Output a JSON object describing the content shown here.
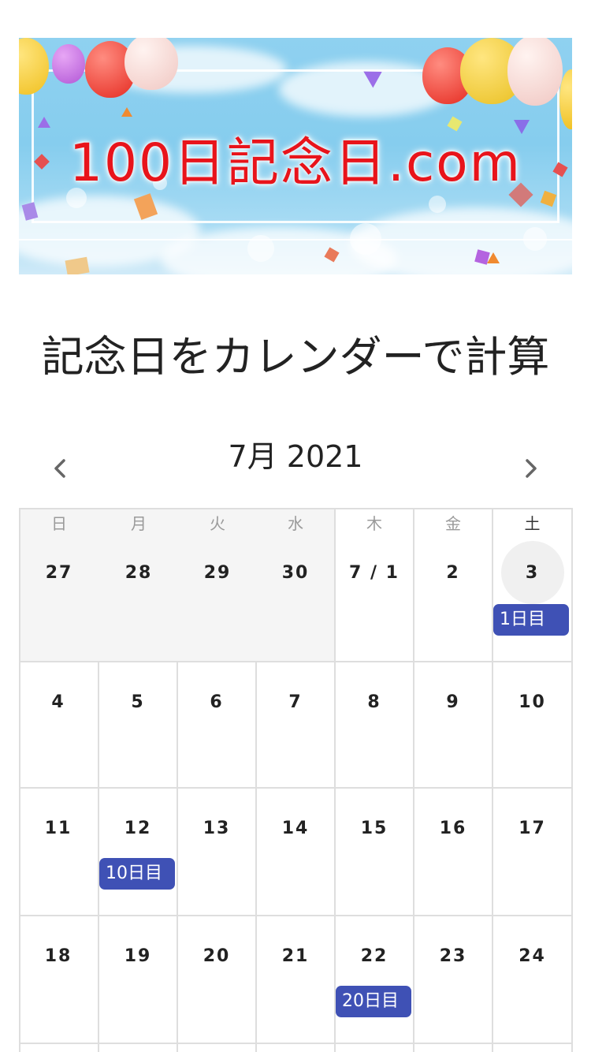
{
  "banner": {
    "title": "100日記念日.com"
  },
  "page_title": "記念日をカレンダーで計算",
  "calendar": {
    "month_label": "7月 2021",
    "prev_icon": "chevron-left-icon",
    "next_icon": "chevron-right-icon",
    "weekdays": [
      "日",
      "月",
      "火",
      "水",
      "木",
      "金",
      "土"
    ],
    "weeks": [
      [
        "27",
        "28",
        "29",
        "30",
        "7 / 1",
        "2",
        "3"
      ],
      [
        "4",
        "5",
        "6",
        "7",
        "8",
        "9",
        "10"
      ],
      [
        "11",
        "12",
        "13",
        "14",
        "15",
        "16",
        "17"
      ],
      [
        "18",
        "19",
        "20",
        "21",
        "22",
        "23",
        "24"
      ],
      [
        "",
        "",
        "",
        "",
        "",
        "",
        ""
      ]
    ],
    "events": [
      {
        "label": "1日目"
      },
      {
        "label": "10日目"
      },
      {
        "label": "20日目"
      }
    ],
    "colors": {
      "event": "#3f51b5",
      "grid": "#dedede",
      "other_month": "#f5f5f5",
      "today_circle": "#f0f0f0"
    }
  }
}
